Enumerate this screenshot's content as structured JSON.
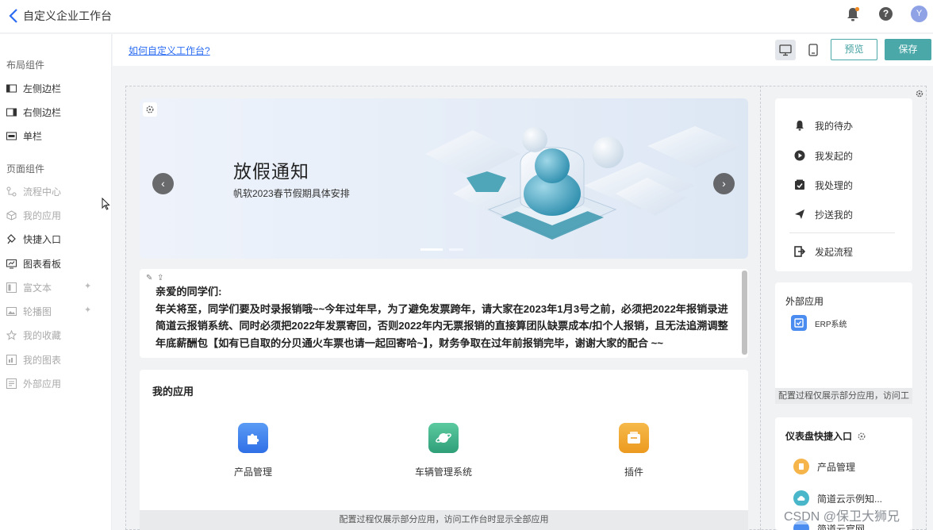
{
  "header": {
    "title": "自定义企业工作台",
    "avatar_letter": "Y"
  },
  "sidebar": {
    "layout_section": "布局组件",
    "layout_items": [
      {
        "label": "左侧边栏"
      },
      {
        "label": "右侧边栏"
      },
      {
        "label": "单栏"
      }
    ],
    "page_section": "页面组件",
    "page_items": [
      {
        "label": "流程中心"
      },
      {
        "label": "我的应用"
      },
      {
        "label": "快捷入口"
      },
      {
        "label": "图表看板"
      },
      {
        "label": "富文本"
      },
      {
        "label": "轮播图"
      },
      {
        "label": "我的收藏"
      },
      {
        "label": "我的图表"
      },
      {
        "label": "外部应用"
      }
    ]
  },
  "toolbar": {
    "help_link": "如何自定义工作台?",
    "preview_label": "预览",
    "save_label": "保存"
  },
  "banner": {
    "title": "放假通知",
    "subtitle": "帆软2023春节假期具体安排"
  },
  "notice": {
    "greeting": "亲爱的同学们:",
    "body": "年关将至，同学们要及时录报销哦~~今年过年早，为了避免发票跨年，请大家在2023年1月3号之前，必须把2022年报销录进简道云报销系统、同时必须把2022年发票寄回，否则2022年内无票报销的直接算团队缺票成本/扣个人报销，且无法追溯调整年底薪酬包【如有已自取的分贝通火车票也请一起回寄哈~】，财务争取在过年前报销完毕，谢谢大家的配合 ~~"
  },
  "apps": {
    "title": "我的应用",
    "items": [
      {
        "label": "产品管理",
        "color": "#3d7cf0"
      },
      {
        "label": "车辆管理系统",
        "color": "#3fb58a"
      },
      {
        "label": "插件",
        "color": "#f0a22b"
      }
    ],
    "footer": "配置过程仅展示部分应用，访问工作台时显示全部应用"
  },
  "todo": {
    "items": [
      {
        "label": "我的待办"
      },
      {
        "label": "我发起的"
      },
      {
        "label": "我处理的"
      },
      {
        "label": "抄送我的"
      }
    ],
    "start_label": "发起流程"
  },
  "external": {
    "title": "外部应用",
    "item": "ERP系统",
    "footer": "配置过程仅展示部分应用，访问工"
  },
  "dashboard": {
    "title": "仪表盘快捷入口",
    "items": [
      {
        "label": "产品管理"
      },
      {
        "label": "简道云示例知..."
      },
      {
        "label": "简道云官网"
      }
    ]
  },
  "watermark": "CSDN @保卫大狮兄"
}
